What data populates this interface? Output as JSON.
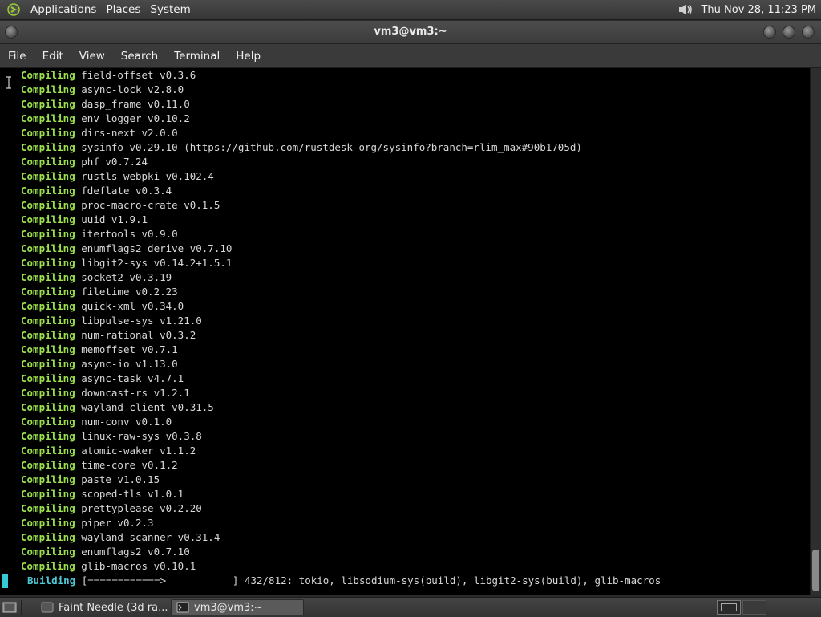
{
  "top_panel": {
    "menus": [
      "Applications",
      "Places",
      "System"
    ],
    "clock": "Thu Nov 28, 11:23 PM"
  },
  "window": {
    "title": "vm3@vm3:~"
  },
  "menubar": [
    "File",
    "Edit",
    "View",
    "Search",
    "Terminal",
    "Help"
  ],
  "terminal": {
    "lines": [
      {
        "kw": "Compiling",
        "text": "field-offset v0.3.6"
      },
      {
        "kw": "Compiling",
        "text": "async-lock v2.8.0"
      },
      {
        "kw": "Compiling",
        "text": "dasp_frame v0.11.0"
      },
      {
        "kw": "Compiling",
        "text": "env_logger v0.10.2"
      },
      {
        "kw": "Compiling",
        "text": "dirs-next v2.0.0"
      },
      {
        "kw": "Compiling",
        "text": "sysinfo v0.29.10 (https://github.com/rustdesk-org/sysinfo?branch=rlim_max#90b1705d)"
      },
      {
        "kw": "Compiling",
        "text": "phf v0.7.24"
      },
      {
        "kw": "Compiling",
        "text": "rustls-webpki v0.102.4"
      },
      {
        "kw": "Compiling",
        "text": "fdeflate v0.3.4"
      },
      {
        "kw": "Compiling",
        "text": "proc-macro-crate v0.1.5"
      },
      {
        "kw": "Compiling",
        "text": "uuid v1.9.1"
      },
      {
        "kw": "Compiling",
        "text": "itertools v0.9.0"
      },
      {
        "kw": "Compiling",
        "text": "enumflags2_derive v0.7.10"
      },
      {
        "kw": "Compiling",
        "text": "libgit2-sys v0.14.2+1.5.1"
      },
      {
        "kw": "Compiling",
        "text": "socket2 v0.3.19"
      },
      {
        "kw": "Compiling",
        "text": "filetime v0.2.23"
      },
      {
        "kw": "Compiling",
        "text": "quick-xml v0.34.0"
      },
      {
        "kw": "Compiling",
        "text": "libpulse-sys v1.21.0"
      },
      {
        "kw": "Compiling",
        "text": "num-rational v0.3.2"
      },
      {
        "kw": "Compiling",
        "text": "memoffset v0.7.1"
      },
      {
        "kw": "Compiling",
        "text": "async-io v1.13.0"
      },
      {
        "kw": "Compiling",
        "text": "async-task v4.7.1"
      },
      {
        "kw": "Compiling",
        "text": "downcast-rs v1.2.1"
      },
      {
        "kw": "Compiling",
        "text": "wayland-client v0.31.5"
      },
      {
        "kw": "Compiling",
        "text": "num-conv v0.1.0"
      },
      {
        "kw": "Compiling",
        "text": "linux-raw-sys v0.3.8"
      },
      {
        "kw": "Compiling",
        "text": "atomic-waker v1.1.2"
      },
      {
        "kw": "Compiling",
        "text": "time-core v0.1.2"
      },
      {
        "kw": "Compiling",
        "text": "paste v1.0.15"
      },
      {
        "kw": "Compiling",
        "text": "scoped-tls v1.0.1"
      },
      {
        "kw": "Compiling",
        "text": "prettyplease v0.2.20"
      },
      {
        "kw": "Compiling",
        "text": "piper v0.2.3"
      },
      {
        "kw": "Compiling",
        "text": "wayland-scanner v0.31.4"
      },
      {
        "kw": "Compiling",
        "text": "enumflags2 v0.7.10"
      },
      {
        "kw": "Compiling",
        "text": "glib-macros v0.10.1"
      }
    ],
    "progress": {
      "kw": "Building",
      "bar": "[============>           ]",
      "status": "432/812: tokio, libsodium-sys(build), libgit2-sys(build), glib-macros"
    }
  },
  "taskbar": {
    "tasks": [
      {
        "label": "Faint Needle (3d ra...",
        "active": false
      },
      {
        "label": "vm3@vm3:~",
        "active": true
      }
    ]
  },
  "colors": {
    "compiling": "#9be14d",
    "building": "#4ec9d6",
    "terminal_bg": "#000000"
  }
}
